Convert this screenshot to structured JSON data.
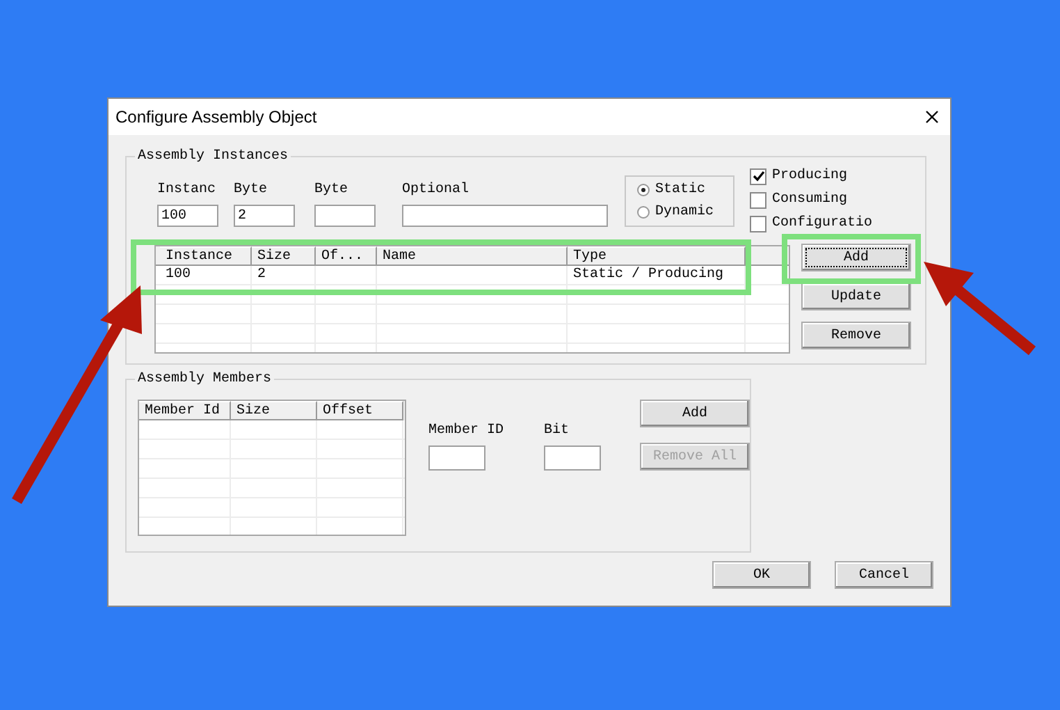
{
  "window": {
    "title": "Configure Assembly Object"
  },
  "instances": {
    "title": "Assembly Instances",
    "fields": [
      {
        "label": "Instanc",
        "value": "100"
      },
      {
        "label": "Byte",
        "value": "2"
      },
      {
        "label": "Byte"
      },
      {
        "label": "Optional"
      }
    ],
    "type_options": [
      {
        "label": "Static",
        "selected": true
      },
      {
        "label": "Dynamic",
        "selected": false
      }
    ],
    "flags": [
      {
        "label": "Producing",
        "checked": true
      },
      {
        "label": "Consuming",
        "checked": false
      },
      {
        "label": "Configuratio",
        "checked": false
      }
    ],
    "table": {
      "columns": [
        "Instance",
        "Size",
        "Of...",
        "Name",
        "Type"
      ],
      "rows": [
        {
          "instance": "100",
          "size": "2",
          "type": "Static / Producing"
        }
      ]
    },
    "buttons": [
      {
        "label": "Add",
        "focused": true
      },
      {
        "label": "Update",
        "focused": false
      },
      {
        "label": "Remove",
        "focused": false
      }
    ]
  },
  "members": {
    "title": "Assembly Members",
    "table": {
      "columns": [
        "Member Id",
        "Size",
        "Offset"
      ]
    },
    "fields": [
      {
        "label": "Member ID"
      },
      {
        "label": "Bit"
      }
    ],
    "buttons": [
      {
        "label": "Add",
        "disabled": false
      },
      {
        "label": "Remove All",
        "disabled": true
      }
    ]
  },
  "buttons": [
    {
      "label": "OK"
    },
    {
      "label": "Cancel"
    }
  ]
}
